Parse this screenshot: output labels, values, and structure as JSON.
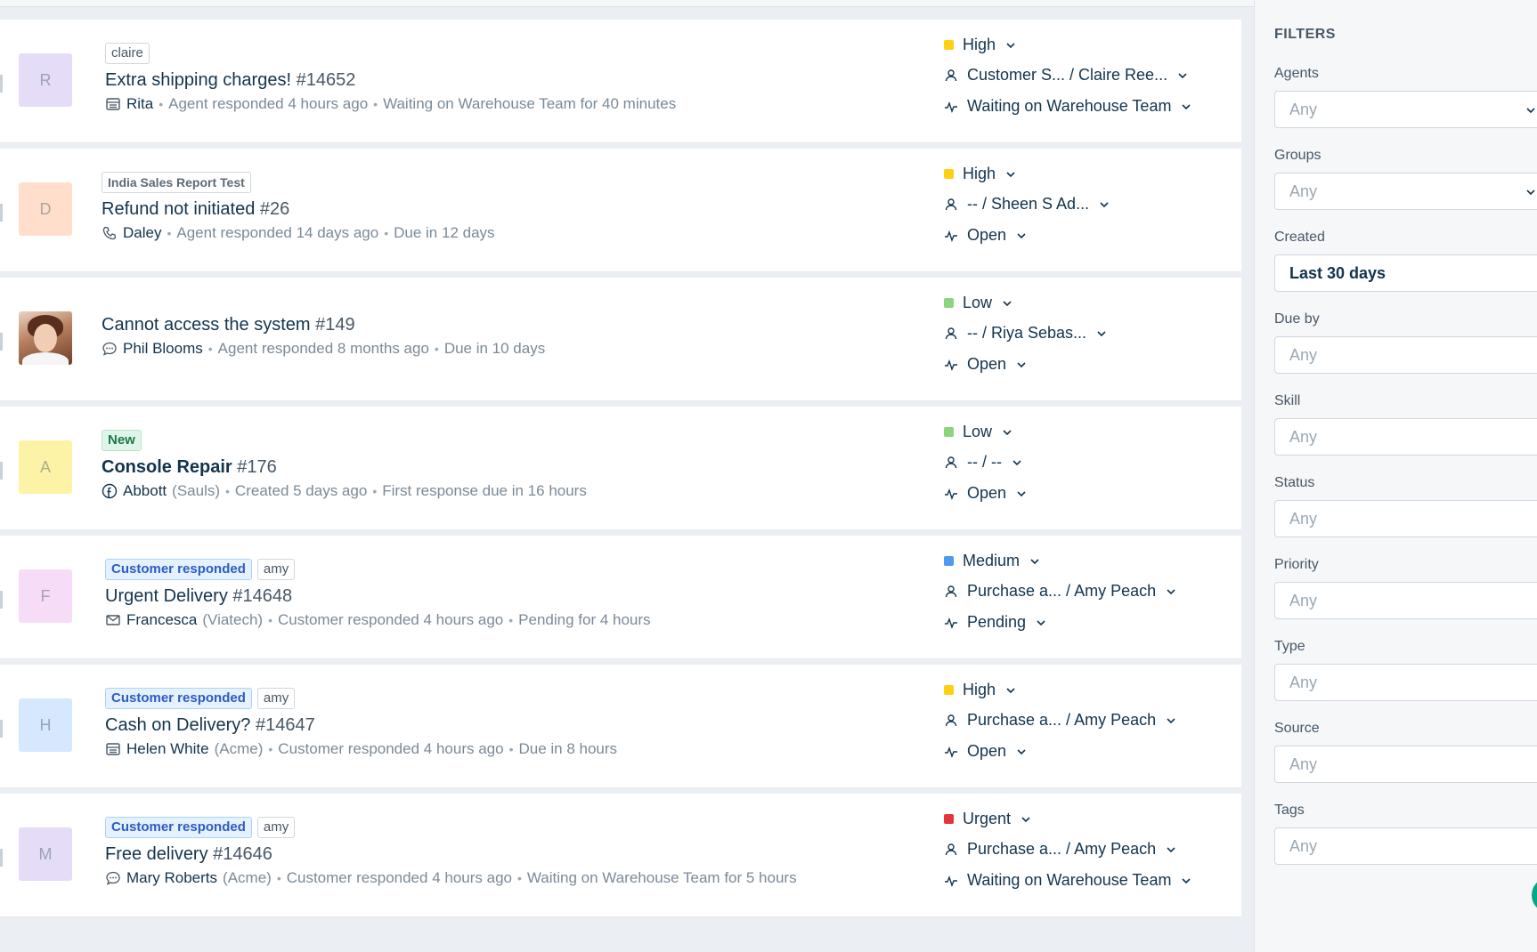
{
  "tickets": [
    {
      "avatar_letter": "R",
      "avatar_color": "#e5dcf7",
      "tags": [
        {
          "text": "claire",
          "kind": "plain"
        }
      ],
      "title": "Extra shipping charges!",
      "number": "#14652",
      "channel": "portal",
      "requester": "Rita",
      "company": "",
      "activity": "Agent responded 4 hours ago",
      "status_note": "Waiting on Warehouse Team for 40 minutes",
      "priority": "High",
      "priority_color": "#ffd012",
      "assignee": "Customer S... / Claire Ree...",
      "status": "Waiting on Warehouse Team"
    },
    {
      "avatar_letter": "D",
      "avatar_color": "#ffdfcc",
      "tags": [
        {
          "text": "India Sales Report Test",
          "kind": "org"
        }
      ],
      "title": "Refund not initiated",
      "number": "#26",
      "channel": "phone",
      "requester": "Daley",
      "company": "",
      "activity": "Agent responded 14 days ago",
      "status_note": "Due in 12 days",
      "priority": "High",
      "priority_color": "#ffd012",
      "assignee": "-- / Sheen S Ad...",
      "status": "Open"
    },
    {
      "avatar_letter": "",
      "avatar_color": "photo",
      "tags": [],
      "title": "Cannot access the system",
      "number": "#149",
      "channel": "chat",
      "requester": "Phil Blooms",
      "company": "",
      "activity": "Agent responded 8 months ago",
      "status_note": "Due in 10 days",
      "priority": "Low",
      "priority_color": "#8cd47e",
      "assignee": "-- / Riya Sebas...",
      "status": "Open"
    },
    {
      "avatar_letter": "A",
      "avatar_color": "#fdf3a6",
      "tags": [
        {
          "text": "New",
          "kind": "new"
        }
      ],
      "title": "Console Repair",
      "number": "#176",
      "channel": "facebook",
      "requester": "Abbott",
      "company": "(Sauls)",
      "activity": "Created 5 days ago",
      "status_note": "First response due in 16 hours",
      "priority": "Low",
      "priority_color": "#8cd47e",
      "assignee": "-- / --",
      "status": "Open"
    },
    {
      "avatar_letter": "F",
      "avatar_color": "#f6dcf6",
      "tags": [
        {
          "text": "Customer responded",
          "kind": "resp"
        },
        {
          "text": "amy",
          "kind": "plain"
        }
      ],
      "title": "Urgent Delivery",
      "number": "#14648",
      "channel": "email",
      "requester": "Francesca",
      "company": "(Viatech)",
      "activity": "Customer responded 4 hours ago",
      "status_note": "Pending for 4 hours",
      "priority": "Medium",
      "priority_color": "#4d9af0",
      "assignee": "Purchase a... / Amy Peach",
      "status": "Pending"
    },
    {
      "avatar_letter": "H",
      "avatar_color": "#d6e8fd",
      "tags": [
        {
          "text": "Customer responded",
          "kind": "resp"
        },
        {
          "text": "amy",
          "kind": "plain"
        }
      ],
      "title": "Cash on Delivery?",
      "number": "#14647",
      "channel": "portal",
      "requester": "Helen White",
      "company": "(Acme)",
      "activity": "Customer responded 4 hours ago",
      "status_note": "Due in 8 hours",
      "priority": "High",
      "priority_color": "#ffd012",
      "assignee": "Purchase a... / Amy Peach",
      "status": "Open"
    },
    {
      "avatar_letter": "M",
      "avatar_color": "#e5dcf7",
      "tags": [
        {
          "text": "Customer responded",
          "kind": "resp"
        },
        {
          "text": "amy",
          "kind": "plain"
        }
      ],
      "title": "Free delivery",
      "number": "#14646",
      "channel": "chat",
      "requester": "Mary Roberts",
      "company": "(Acme)",
      "activity": "Customer responded 4 hours ago",
      "status_note": "Waiting on Warehouse Team for 5 hours",
      "priority": "Urgent",
      "priority_color": "#e43538",
      "assignee": "Purchase a... / Amy Peach",
      "status": "Waiting on Warehouse Team"
    }
  ],
  "filters": {
    "title": "FILTERS",
    "fields": [
      {
        "label": "Agents",
        "value": "Any",
        "selected": false,
        "dropdown": true
      },
      {
        "label": "Groups",
        "value": "Any",
        "selected": false,
        "dropdown": true
      },
      {
        "label": "Created",
        "value": "Last 30 days",
        "selected": true,
        "dropdown": false
      },
      {
        "label": "Due by",
        "value": "Any",
        "selected": false,
        "dropdown": false
      },
      {
        "label": "Skill",
        "value": "Any",
        "selected": false,
        "dropdown": false
      },
      {
        "label": "Status",
        "value": "Any",
        "selected": false,
        "dropdown": false
      },
      {
        "label": "Priority",
        "value": "Any",
        "selected": false,
        "dropdown": false
      },
      {
        "label": "Type",
        "value": "Any",
        "selected": false,
        "dropdown": false
      },
      {
        "label": "Source",
        "value": "Any",
        "selected": false,
        "dropdown": false
      },
      {
        "label": "Tags",
        "value": "Any",
        "selected": false,
        "dropdown": false
      }
    ]
  }
}
